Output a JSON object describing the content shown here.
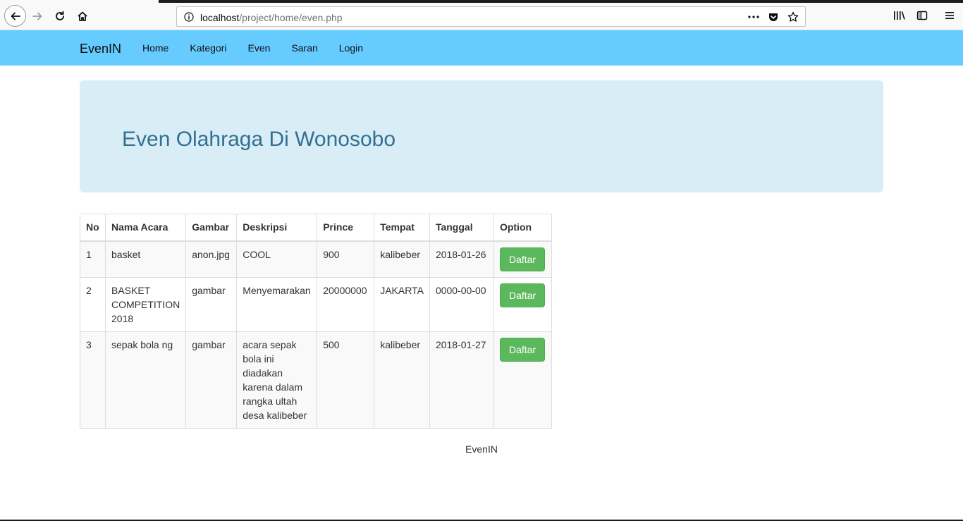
{
  "browser": {
    "url_host": "localhost",
    "url_path": "/project/home/even.php"
  },
  "navbar": {
    "brand": "EvenIN",
    "links": [
      "Home",
      "Kategori",
      "Even",
      "Saran",
      "Login"
    ]
  },
  "jumbotron": {
    "title": "Even Olahraga Di Wonosobo"
  },
  "table": {
    "headers": [
      "No",
      "Nama Acara",
      "Gambar",
      "Deskripsi",
      "Prince",
      "Tempat",
      "Tanggal",
      "Option"
    ],
    "rows": [
      {
        "no": "1",
        "nama": "basket",
        "gambar": "anon.jpg",
        "deskripsi": "COOL",
        "prince": "900",
        "tempat": "kalibeber",
        "tanggal": "2018-01-26",
        "option": "Daftar"
      },
      {
        "no": "2",
        "nama": "BASKET COMPETITION 2018",
        "gambar": "gambar",
        "deskripsi": "Menyemarakan",
        "prince": "20000000",
        "tempat": "JAKARTA",
        "tanggal": "0000-00-00",
        "option": "Daftar"
      },
      {
        "no": "3",
        "nama": "sepak bola ng",
        "gambar": "gambar",
        "deskripsi": "acara sepak bola ini diadakan karena dalam rangka ultah desa kalibeber",
        "prince": "500",
        "tempat": "kalibeber",
        "tanggal": "2018-01-27",
        "option": "Daftar"
      }
    ]
  },
  "footer": {
    "text": "EvenIN"
  },
  "icons": {
    "back": "back-arrow-icon",
    "forward": "forward-arrow-icon",
    "reload": "reload-icon",
    "home": "home-icon",
    "info": "info-icon",
    "more": "more-icon",
    "pocket": "pocket-icon",
    "bookmark": "star-icon",
    "library": "library-icon",
    "sidebar": "sidebar-icon",
    "menu": "hamburger-menu-icon"
  },
  "colors": {
    "navbar_bg": "#66cbff",
    "jumbotron_bg": "#d9edf7",
    "jumbotron_title": "#31708f",
    "button_success": "#5cb85c"
  }
}
